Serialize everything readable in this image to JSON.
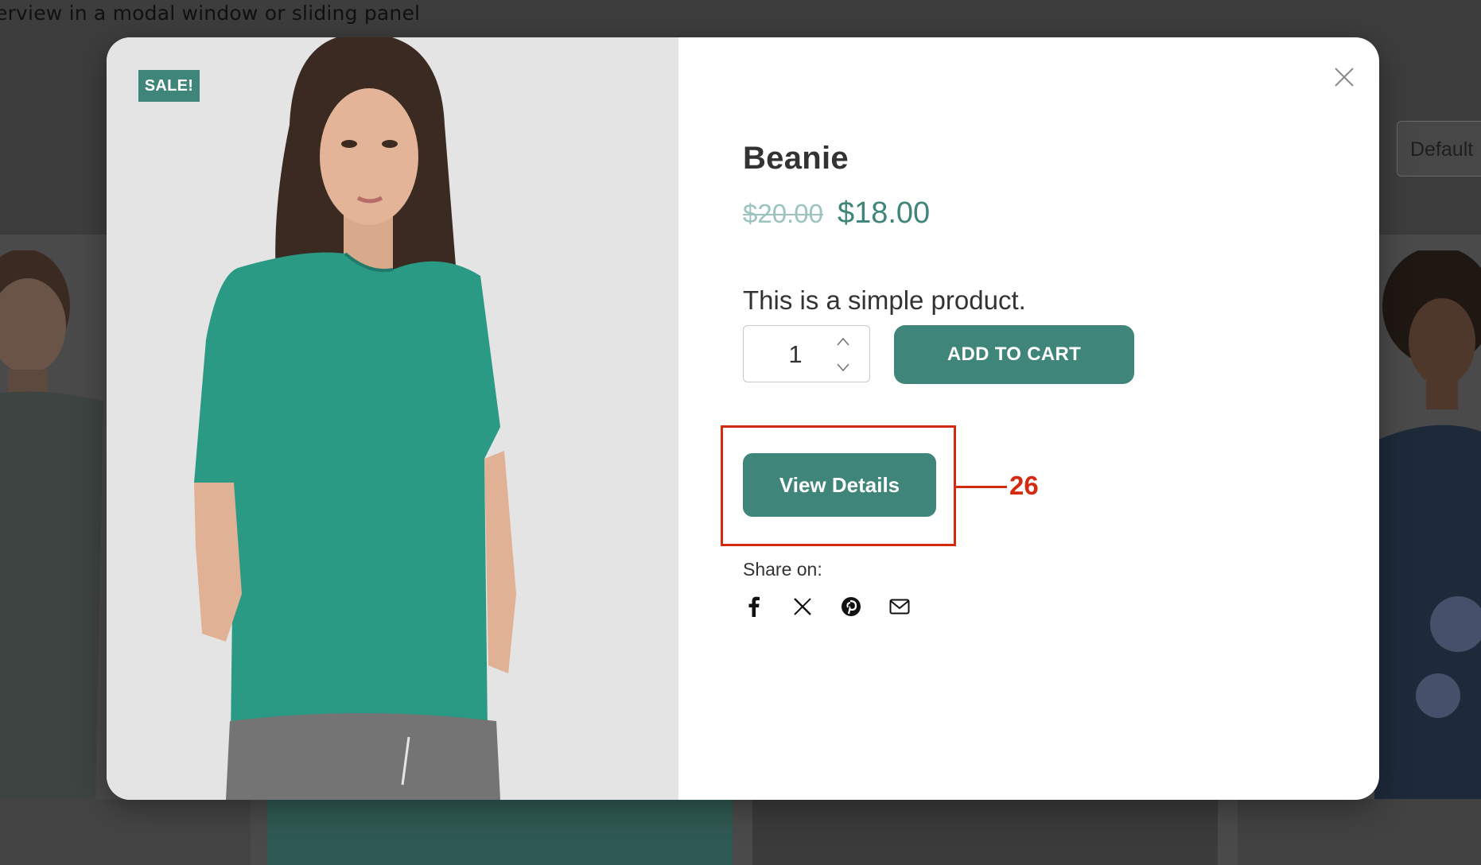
{
  "background": {
    "caption": "erview in a modal window or sliding panel",
    "sort_select": "Default"
  },
  "modal": {
    "badge": "SALE!",
    "close_icon": "close-icon",
    "product": {
      "title": "Beanie",
      "price_original": "$20.00",
      "price_sale": "$18.00",
      "description": "This is a simple product."
    },
    "quantity": "1",
    "add_to_cart_label": "ADD TO CART",
    "view_details_label": "View Details",
    "annotation_number": "26",
    "share": {
      "label": "Share on:",
      "icons": [
        "facebook-icon",
        "x-icon",
        "pinterest-icon",
        "email-icon"
      ]
    }
  },
  "colors": {
    "accent": "#3f857a",
    "price_strike": "#9cc4be",
    "annotation": "#d42b10",
    "overlay": "#3d3d3d",
    "modal_bg": "#ffffff"
  }
}
